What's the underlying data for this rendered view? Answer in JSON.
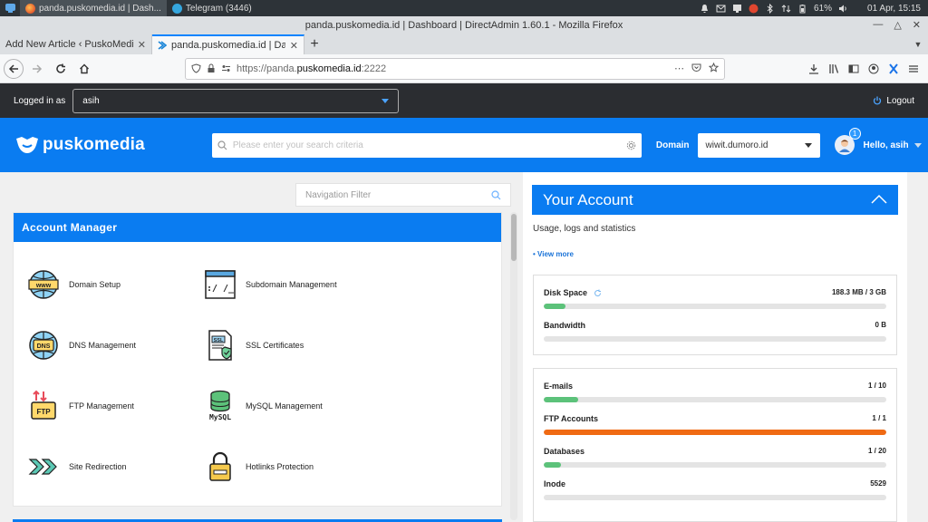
{
  "taskbar": {
    "tasks": [
      {
        "label": "panda.puskomedia.id | Dash..."
      },
      {
        "label": "Telegram (3446)"
      }
    ],
    "battery": "61%",
    "clock": "01 Apr, 15:15"
  },
  "window": {
    "title": "panda.puskomedia.id | Dashboard | DirectAdmin 1.60.1 - Mozilla Firefox"
  },
  "tabs": [
    {
      "label": "Add New Article ‹ PuskoMedia In"
    },
    {
      "label": "panda.puskomedia.id | Dash"
    }
  ],
  "url": {
    "prefix": "https://panda.",
    "host": "puskomedia.id",
    "suffix": ":2222"
  },
  "login_bar": {
    "label": "Logged in as",
    "user": "asih",
    "logout": "Logout"
  },
  "header": {
    "logo": "puskomedia",
    "search_placeholder": "Please enter your search criteria",
    "domain_label": "Domain",
    "domain_value": "wiwit.dumoro.id",
    "notif_count": "1",
    "greeting": "Hello, asih"
  },
  "nav_filter": {
    "placeholder": "Navigation Filter"
  },
  "account_manager": {
    "title": "Account Manager",
    "items": [
      {
        "label": "Domain Setup",
        "icon": "www-globe-icon"
      },
      {
        "label": "Subdomain Management",
        "icon": "terminal-window-icon"
      },
      {
        "label": "DNS Management",
        "icon": "dns-globe-icon"
      },
      {
        "label": "SSL Certificates",
        "icon": "ssl-certificate-icon"
      },
      {
        "label": "FTP Management",
        "icon": "ftp-upload-icon"
      },
      {
        "label": "MySQL Management",
        "icon": "mysql-database-icon"
      },
      {
        "label": "Site Redirection",
        "icon": "redirect-arrows-icon"
      },
      {
        "label": "Hotlinks Protection",
        "icon": "padlock-icon"
      }
    ]
  },
  "your_account": {
    "title": "Your Account",
    "subtitle": "Usage, logs and statistics",
    "view_more": "• View more",
    "usage": [
      {
        "label": "Disk Space",
        "value": "188.3 MB / 3 GB",
        "fill": 0.063,
        "color": "#5cc27a"
      },
      {
        "label": "Bandwidth",
        "value": "0 B",
        "fill": 0,
        "color": "#5cc27a"
      }
    ],
    "counts": [
      {
        "label": "E-mails",
        "value": "1 / 10",
        "fill": 0.1,
        "color": "#5cc27a"
      },
      {
        "label": "FTP Accounts",
        "value": "1 / 1",
        "fill": 1.0,
        "color": "#f06a13"
      },
      {
        "label": "Databases",
        "value": "1 / 20",
        "fill": 0.05,
        "color": "#5cc27a"
      },
      {
        "label": "Inode",
        "value": "5529",
        "fill": 0,
        "color": "#5cc27a"
      }
    ]
  }
}
